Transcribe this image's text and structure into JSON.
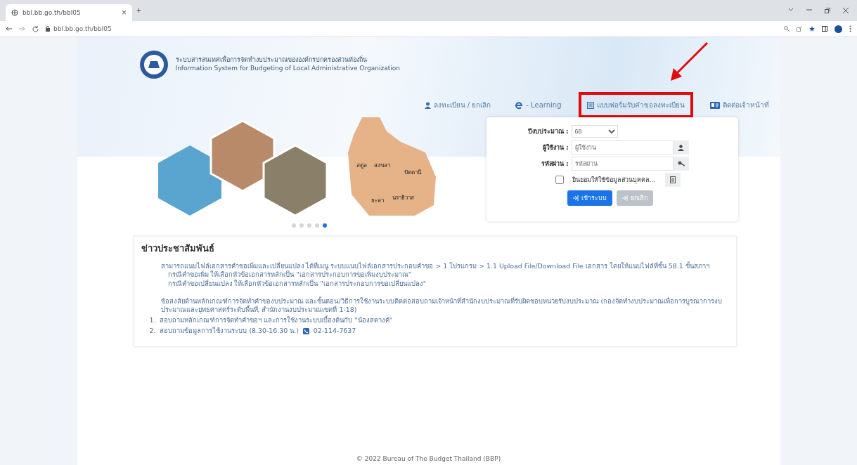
{
  "browser": {
    "tab_title": "bbl.bb.go.th/bbl05",
    "tab_close": "×",
    "new_tab": "+",
    "url": "bbl.bb.go.th/bbl05"
  },
  "header": {
    "title_th": "ระบบสารสนเทศเพื่อการจัดทำงบประมาณขององค์กรปกครองส่วนท้องถิ่น",
    "title_en": "Information System for Budgeting of Local Administrative Organization"
  },
  "nav": [
    {
      "kind": "user",
      "label": "ลงทะเบียน / ยกเลิก",
      "highlighted": false
    },
    {
      "kind": "elearning",
      "label": "- Learning",
      "highlighted": false
    },
    {
      "kind": "form",
      "label": "แบบฟอร์มรับคำขอลงทะเบียน",
      "highlighted": true
    },
    {
      "kind": "contact",
      "label": "ติดต่อเจ้าหน้าที่",
      "highlighted": false
    }
  ],
  "carousel": {
    "map_labels": [
      "สตูล",
      "สงขลา",
      "ปัตตานี",
      "ยะลา",
      "นราธิวาส"
    ],
    "dots": [
      {
        "selected": false
      },
      {
        "selected": false
      },
      {
        "selected": false
      },
      {
        "selected": false
      },
      {
        "selected": true
      }
    ]
  },
  "login": {
    "year_label": "ปีงบประมาณ :",
    "year_value": "68",
    "user_label": "ผู้ใช้งาน :",
    "user_placeholder": "ผู้ใช้งาน",
    "pass_label": "รหัสผ่าน :",
    "pass_placeholder": "รหัสผ่าน",
    "consent": {
      "label": "ยินยอมให้ใช้ข้อมูลส่วนบุคคล...",
      "checked": false
    },
    "buttons": [
      {
        "kind": "primary",
        "label": "เข้าระบบ",
        "disabled": false
      },
      {
        "kind": "secondary",
        "label": "ยกเลิก",
        "disabled": true
      }
    ]
  },
  "news": {
    "title": "ข่าวประชาสัมพันธ์",
    "paragraph_1": "สามารถแนบไฟล์เอกสารคำขอเพิ่มและเปลี่ยนแปลง ได้ที่เมนู ระบบแนบไฟล์เอกสารประกอบคำขอ > 1 โปรแกรม > 1.1 Upload File/Download File เอกสาร โดยให้แนบไฟล์ที่ขั้น 58.1 ขั้นสภาฯ",
    "sub_lines": [
      "กรณีคำขอเพิ่ม ให้เลือกหัวข้อเอกสารหลักเป็น \"เอกสารประกอบการขอเพิ่มงบประมาณ\"",
      "กรณีคำขอเปลี่ยนแปลง ให้เลือกหัวข้อเอกสารหลักเป็น \"เอกสารประกอบการขอเปลี่ยนแปลง\""
    ],
    "paragraph_2": "ข้อสงสัยด้านหลักเกณฑ์การจัดทำคำของบประมาณ และขั้นตอน/วิธีการใช้งานระบบติดต่อสอบถามเจ้าหน้าที่สำนักงบประมาณที่รับผิดชอบหน่วยรับงบประมาณ (กองจัดทำงบประมาณเพื่อการบูรณาการงบประมาณและยุทธศาสตร์ระดับพื้นที่, สำนักงานงบประมาณเขตที่ 1-18)",
    "list": [
      {
        "number": "1.",
        "text": "สอบถามหลักเกณฑ์การจัดทำคำขอฯ และการใช้งานระบบเบื้องต้นกับ \"น้องสตางค์\""
      },
      {
        "number": "2.",
        "text": "สอบถามข้อมูลการใช้งานระบบ (8.30-16.30 น.)",
        "phone": "02-114-7637"
      }
    ]
  },
  "footer": "© 2022 Bureau of The Budget Thailand (BBP)"
}
